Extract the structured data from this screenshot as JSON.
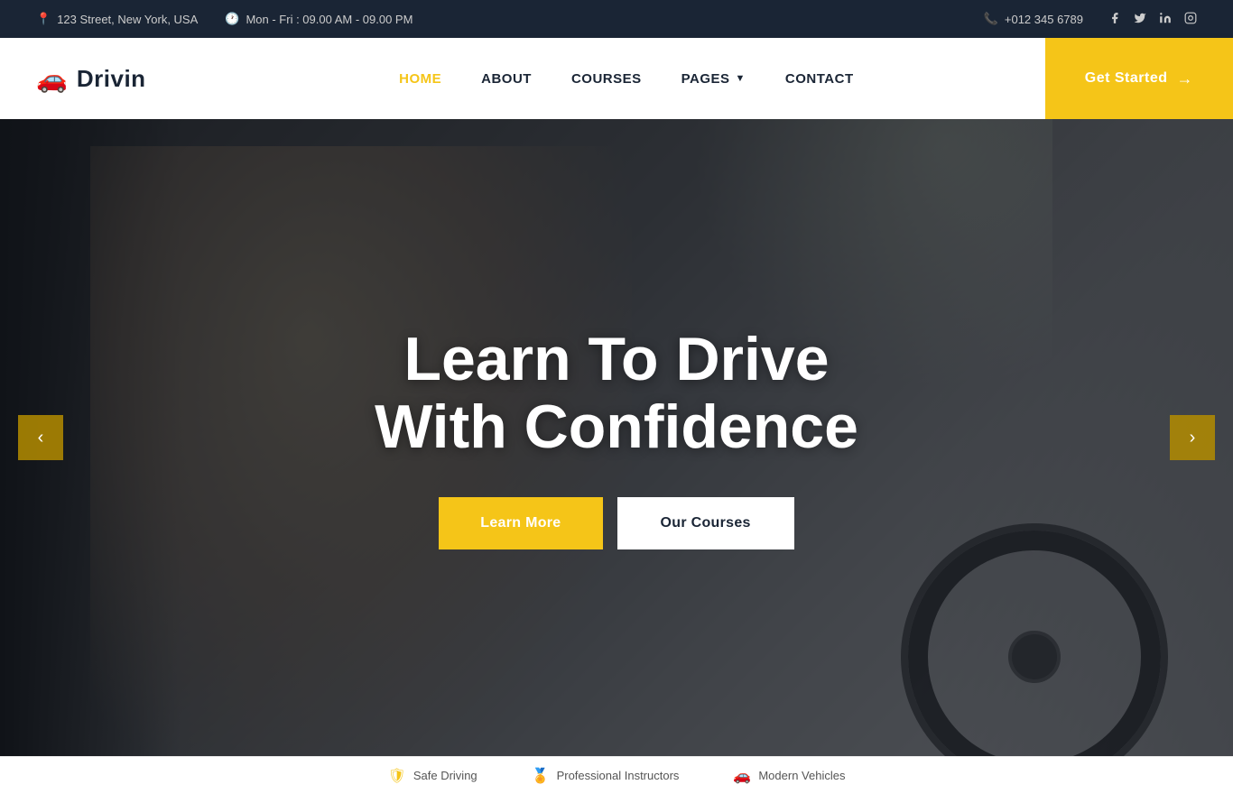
{
  "topbar": {
    "address": "123 Street, New York, USA",
    "hours": "Mon - Fri : 09.00 AM - 09.00 PM",
    "phone": "+012 345 6789",
    "address_icon": "📍",
    "clock_icon": "🕐",
    "phone_icon": "📞"
  },
  "navbar": {
    "brand_icon": "🚗",
    "brand_name": "Drivin",
    "links": [
      {
        "label": "HOME",
        "active": true,
        "has_dropdown": false
      },
      {
        "label": "ABOUT",
        "active": false,
        "has_dropdown": false
      },
      {
        "label": "COURSES",
        "active": false,
        "has_dropdown": false
      },
      {
        "label": "PAGES",
        "active": false,
        "has_dropdown": true
      },
      {
        "label": "CONTACT",
        "active": false,
        "has_dropdown": false
      }
    ],
    "get_started": "Get Started"
  },
  "hero": {
    "title_line1": "Learn To Drive",
    "title_line2": "With Confidence",
    "btn_primary": "Learn More",
    "btn_secondary": "Our Courses"
  },
  "carousel": {
    "prev_label": "‹",
    "next_label": "›"
  },
  "social": {
    "facebook": "f",
    "twitter": "t",
    "linkedin": "in",
    "instagram": "ig"
  },
  "colors": {
    "accent": "#f5c518",
    "dark": "#1a2535",
    "topbar_bg": "#1a2535"
  }
}
